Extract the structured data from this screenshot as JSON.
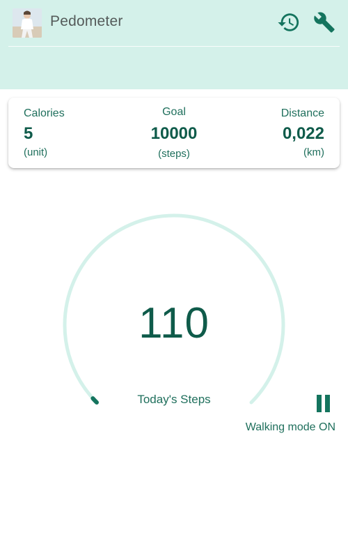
{
  "app": {
    "title": "Pedometer"
  },
  "header": {
    "history_icon": "history-icon",
    "settings_icon": "wrench-icon"
  },
  "stats": {
    "calories": {
      "label": "Calories",
      "value": "5",
      "unit": "(unit)"
    },
    "goal": {
      "label": "Goal",
      "value": "10000",
      "unit": "(steps)"
    },
    "distance": {
      "label": "Distance",
      "value": "0,022",
      "unit": "(km)"
    }
  },
  "gauge": {
    "steps": "110",
    "label": "Today's Steps",
    "progress_fraction": 0.011
  },
  "mode": {
    "status": "Walking mode ON",
    "pause_icon": "pause-icon"
  },
  "colors": {
    "header_bg": "#d4f1ea",
    "accent": "#14745e",
    "text_dark": "#0f5b4a",
    "ring": "#d4f1ea"
  }
}
